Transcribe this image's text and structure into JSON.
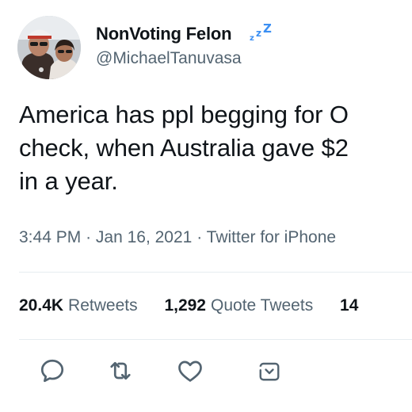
{
  "user": {
    "display_name": "NonVoting Felon",
    "name_emoji": "zzz-sleeping-emoji",
    "handle": "@MichaelTanuvasa"
  },
  "tweet": {
    "lines": [
      "America has ppl begging for O",
      "check, when Australia gave $2",
      "in a year."
    ]
  },
  "meta": {
    "time": "3:44 PM",
    "separator1": "·",
    "date": "Jan 16, 2021",
    "separator2": "·",
    "source": "Twitter for iPhone"
  },
  "stats": {
    "retweets_count": "20.4K",
    "retweets_label": "Retweets",
    "quotes_count": "1,292",
    "quotes_label": "Quote Tweets",
    "likes_count_partial": "14"
  },
  "actions": [
    {
      "name": "reply-icon"
    },
    {
      "name": "retweet-icon"
    },
    {
      "name": "like-icon"
    },
    {
      "name": "share-icon"
    }
  ],
  "colors": {
    "text_primary": "#0f1419",
    "text_secondary": "#536471",
    "divider": "#e6ecf0",
    "emoji_blue": "#3b8ff3"
  }
}
